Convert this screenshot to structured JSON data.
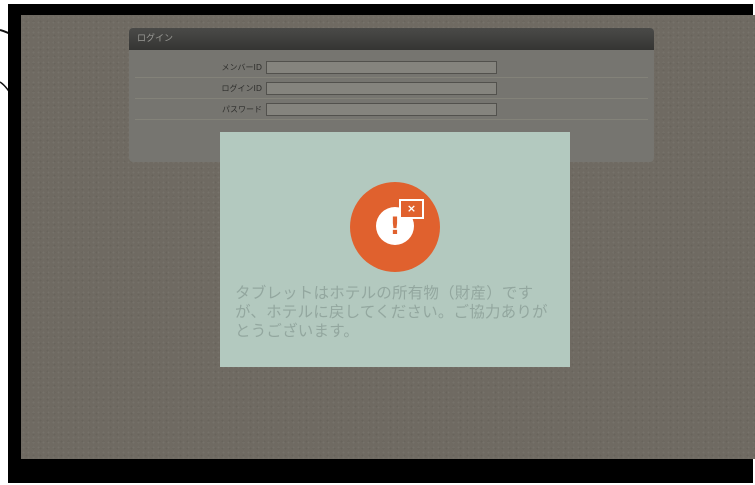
{
  "login": {
    "title": "ログイン",
    "fields": [
      {
        "label": "メンバーID",
        "value": ""
      },
      {
        "label": "ログインID",
        "value": ""
      },
      {
        "label": "パスワード",
        "value": ""
      }
    ]
  },
  "modal": {
    "icon": "alert-exclamation-icon",
    "close_icon": "close-icon",
    "close_glyph": "×",
    "exclamation_glyph": "!",
    "message_lines": [
      "タブレットはホテルの所有物（財産）です",
      "が、ホテルに戻してください。ご協力ありが",
      "とうございます。"
    ]
  },
  "colors": {
    "accent": "#e0612e",
    "modal_bg": "#b3c9bf",
    "screen_bg": "#6f6a62"
  }
}
